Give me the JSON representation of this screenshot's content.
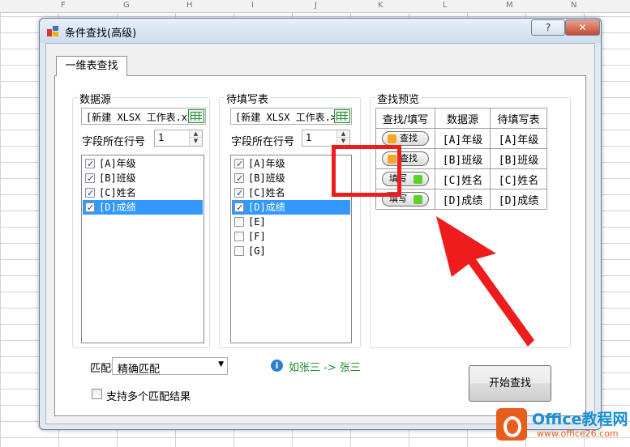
{
  "window": {
    "title": "条件查找(高级)",
    "help_label": "?",
    "close_label": "✕"
  },
  "tab": {
    "label": "一维表查找"
  },
  "source": {
    "group_label": "数据源",
    "file_value": "[新建 XLSX 工作表.x",
    "row_label": "字段所在行号",
    "row_value": "1",
    "items": [
      {
        "text": "[A]年级",
        "checked": true,
        "selected": false
      },
      {
        "text": "[B]班级",
        "checked": true,
        "selected": false
      },
      {
        "text": "[C]姓名",
        "checked": true,
        "selected": false
      },
      {
        "text": "[D]成绩",
        "checked": true,
        "selected": true
      }
    ]
  },
  "target": {
    "group_label": "待填写表",
    "file_value": "[新建 XLSX 工作表.>",
    "row_label": "字段所在行号",
    "row_value": "1",
    "items": [
      {
        "text": "[A]年级",
        "checked": true,
        "selected": false
      },
      {
        "text": "[B]班级",
        "checked": true,
        "selected": false
      },
      {
        "text": "[C]姓名",
        "checked": true,
        "selected": false
      },
      {
        "text": "[D]成绩",
        "checked": true,
        "selected": true
      },
      {
        "text": "[E]",
        "checked": false,
        "selected": false
      },
      {
        "text": "[F]",
        "checked": false,
        "selected": false
      },
      {
        "text": "[G]",
        "checked": false,
        "selected": false
      }
    ]
  },
  "preview": {
    "group_label": "查找预览",
    "headers": [
      "查找/填写",
      "数据源",
      "待填写表"
    ],
    "rows": [
      {
        "mode": "查找",
        "source": "[A]年级",
        "target": "[A]年级"
      },
      {
        "mode": "查找",
        "source": "[B]班级",
        "target": "[B]班级"
      },
      {
        "mode": "填写",
        "source": "[C]姓名",
        "target": "[C]姓名"
      },
      {
        "mode": "填写",
        "source": "[D]成绩",
        "target": "[D]成绩"
      }
    ]
  },
  "match": {
    "label": "匹配模式:",
    "value": "精确匹配",
    "hint": "如张三 -> 张三",
    "multi_label": "支持多个匹配结果",
    "multi_checked": false
  },
  "start_button": "开始查找",
  "sheet": {
    "columns": [
      "F",
      "G",
      "H",
      "I",
      "J",
      "K",
      "L",
      "M",
      "N"
    ]
  },
  "watermark": {
    "name": "Office教程网",
    "url": "www.office26.com"
  },
  "colors": {
    "highlight": "#ee1c1c",
    "selection": "#3399ff",
    "find_dot": "#f5a623",
    "fill_dot": "#5ed12d",
    "hint_text": "#1e8b2e"
  }
}
